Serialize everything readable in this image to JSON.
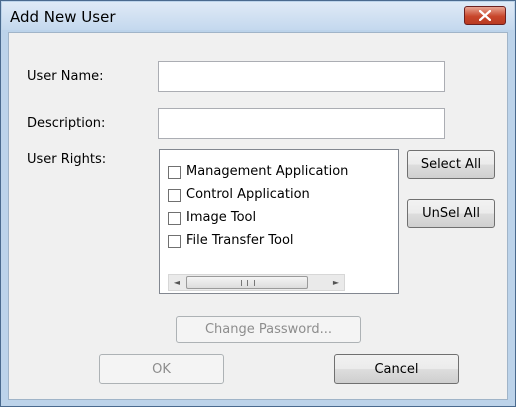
{
  "window": {
    "title": "Add New User",
    "close_label": "close"
  },
  "form": {
    "user_name_label": "User Name:",
    "user_name_value": "",
    "description_label": "Description:",
    "description_value": "",
    "user_rights_label": "User Rights:"
  },
  "rights": {
    "items": [
      {
        "label": "Management Application",
        "checked": false
      },
      {
        "label": "Control Application",
        "checked": false
      },
      {
        "label": "Image Tool",
        "checked": false
      },
      {
        "label": "File Transfer Tool",
        "checked": false
      }
    ],
    "scroll_left_icon": "◄",
    "scroll_right_icon": "►"
  },
  "buttons": {
    "select_all": "Select All",
    "unselect_all": "UnSel All",
    "change_password": "Change Password...",
    "ok": "OK",
    "cancel": "Cancel"
  },
  "colors": {
    "close_button": "#c8462c",
    "title_bar": "#c4d8ee",
    "dialog_bg": "#f0f0f0"
  }
}
